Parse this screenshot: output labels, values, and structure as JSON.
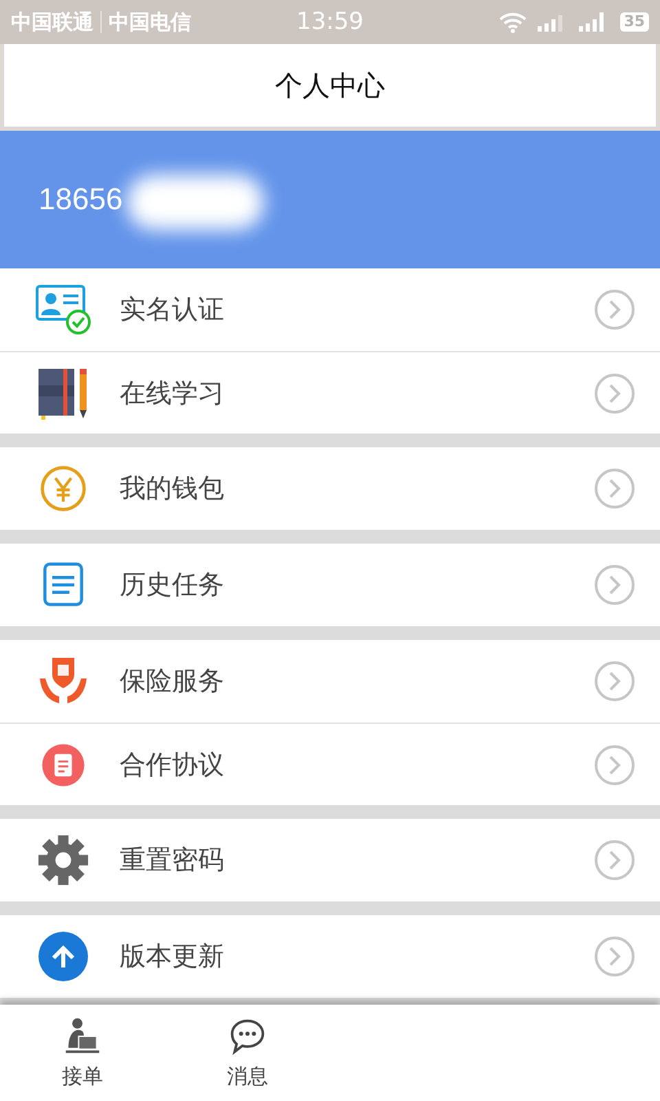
{
  "status_bar": {
    "carriers": [
      "中国联通",
      "中国电信"
    ],
    "time": "13:59",
    "battery": "35"
  },
  "header": {
    "title": "个人中心"
  },
  "profile": {
    "phone": "18656"
  },
  "menu_groups": [
    {
      "items": [
        {
          "label": "实名认证",
          "kind": "id-card"
        },
        {
          "label": "在线学习",
          "kind": "notebook"
        }
      ]
    },
    {
      "items": [
        {
          "label": "我的钱包",
          "kind": "wallet"
        }
      ]
    },
    {
      "items": [
        {
          "label": "历史任务",
          "kind": "list"
        }
      ]
    },
    {
      "items": [
        {
          "label": "保险服务",
          "kind": "insurance"
        },
        {
          "label": "合作协议",
          "kind": "contract"
        }
      ]
    },
    {
      "items": [
        {
          "label": "重置密码",
          "kind": "gear"
        }
      ]
    },
    {
      "items": [
        {
          "label": "版本更新",
          "kind": "update"
        }
      ]
    }
  ],
  "tab_bar": {
    "tabs": [
      {
        "label": "接单",
        "kind": "courier"
      },
      {
        "label": "消息",
        "kind": "chat"
      }
    ]
  }
}
